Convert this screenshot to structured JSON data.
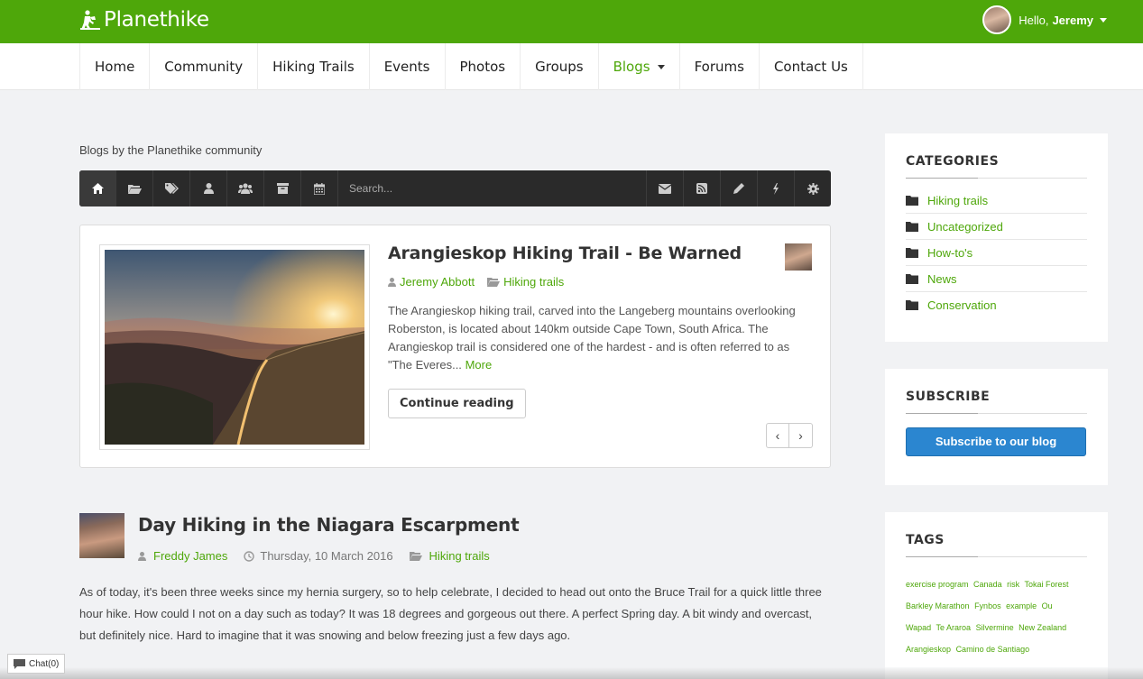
{
  "header": {
    "logo_text": "Planethike",
    "greeting": "Hello,",
    "user_name": "Jeremy"
  },
  "nav": {
    "items": [
      {
        "label": "Home"
      },
      {
        "label": "Community"
      },
      {
        "label": "Hiking Trails"
      },
      {
        "label": "Events"
      },
      {
        "label": "Photos"
      },
      {
        "label": "Groups"
      },
      {
        "label": "Blogs",
        "active": true
      },
      {
        "label": "Forums"
      },
      {
        "label": "Contact Us"
      }
    ]
  },
  "main": {
    "description": "Blogs by the Planethike community",
    "toolbar": {
      "left_icons": [
        "home-icon",
        "folder-icon",
        "tags-icon",
        "user-icon",
        "users-icon",
        "archive-icon",
        "calendar-icon"
      ],
      "search_placeholder": "Search...",
      "right_icons": [
        "envelope-icon",
        "rss-icon",
        "pencil-icon",
        "bolt-icon",
        "gear-icon"
      ]
    },
    "featured": {
      "title": "Arangieskop Hiking Trail - Be Warned",
      "author": "Jeremy Abbott",
      "category": "Hiking trails",
      "excerpt": "The Arangieskop hiking trail, carved into the Langeberg mountains overlooking Roberston, is located about 140km outside Cape Town, South Africa. The Arangieskop trail is considered one of the hardest - and is often referred to as \"The Everes...",
      "more_label": "More",
      "continue_label": "Continue reading",
      "prev_label": "‹",
      "next_label": "›"
    },
    "post": {
      "title": "Day Hiking in the Niagara Escarpment",
      "author": "Freddy James",
      "date": "Thursday, 10 March 2016",
      "category": "Hiking trails",
      "body": "As of today, it's been three weeks since my hernia surgery, so to help celebrate, I decided to head out onto the Bruce Trail for a quick little three hour hike. How could I not on a day such as today? It was 18 degrees and gorgeous out there. A perfect Spring day. A bit windy and overcast, but definitely nice. Hard to imagine that it was snowing and below freezing just a few days ago."
    }
  },
  "sidebar": {
    "categories_title": "CATEGORIES",
    "categories": [
      "Hiking trails",
      "Uncategorized",
      "How-to's",
      "News",
      "Conservation"
    ],
    "subscribe_title": "SUBSCRIBE",
    "subscribe_label": "Subscribe to our blog",
    "tags_title": "TAGS",
    "tags": [
      "exercise program",
      "Canada",
      "risk",
      "Tokai Forest",
      "Barkley Marathon",
      "Fynbos",
      "example",
      "Ou",
      "Wapad",
      "Te Araroa",
      "Silvermine",
      "New Zealand",
      "Arangieskop",
      "Camino de Santiago"
    ]
  },
  "chat": {
    "label": "Chat(0)"
  },
  "colors": {
    "brand_green": "#4ea70a",
    "subscribe_blue": "#2b86d0",
    "toolbar_dark": "#2a2a2a"
  }
}
